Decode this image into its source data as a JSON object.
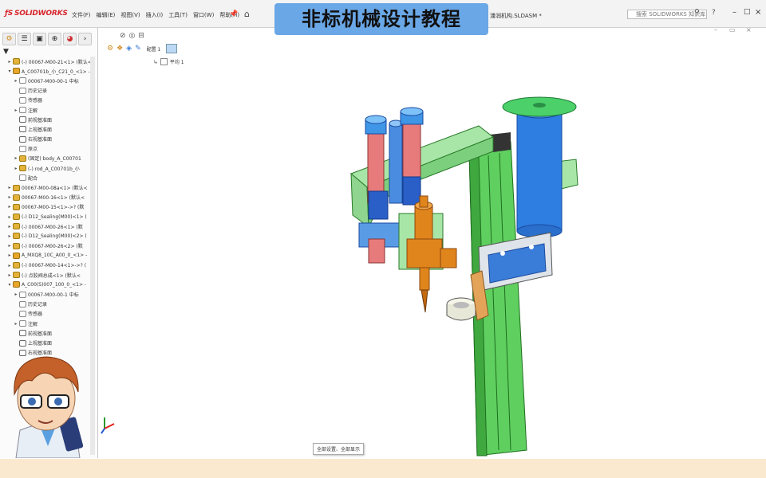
{
  "app": {
    "logo": "SOLIDWORKS"
  },
  "menu": {
    "items": [
      "文件(F)",
      "编辑(E)",
      "视图(V)",
      "插入(I)",
      "工具(T)",
      "窗口(W)",
      "帮助(H)"
    ]
  },
  "document_title": "潘润机构.SLDASM *",
  "search": {
    "placeholder": "搜索 SOLIDWORKS 知识库"
  },
  "banner": {
    "text": "非标机械设计教程"
  },
  "feature_tree": {
    "rows": [
      {
        "label": "(-) 00067-M00-21<1> (默认<",
        "icon": "part",
        "arrow": "▸",
        "indent": 1
      },
      {
        "label": "A_C00701b_小_C21_0_<1> -",
        "icon": "asm",
        "arrow": "▾",
        "indent": 1
      },
      {
        "label": "00067-M00-00-1 中标",
        "icon": "folder",
        "arrow": "▸",
        "indent": 2
      },
      {
        "label": "历史记录",
        "icon": "folder",
        "arrow": "",
        "indent": 2
      },
      {
        "label": "传感器",
        "icon": "folder",
        "arrow": "",
        "indent": 2
      },
      {
        "label": "注解",
        "icon": "folder",
        "arrow": "▸",
        "indent": 2
      },
      {
        "label": "前视基准面",
        "icon": "plane",
        "arrow": "",
        "indent": 2
      },
      {
        "label": "上视基准面",
        "icon": "plane",
        "arrow": "",
        "indent": 2
      },
      {
        "label": "右视基准面",
        "icon": "plane",
        "arrow": "",
        "indent": 2
      },
      {
        "label": "原点",
        "icon": "folder",
        "arrow": "",
        "indent": 2
      },
      {
        "label": "(固定) body_A_C00701",
        "icon": "part",
        "arrow": "▸",
        "indent": 2
      },
      {
        "label": "(-) rod_A_C00701b_小",
        "icon": "part",
        "arrow": "▸",
        "indent": 2
      },
      {
        "label": "配合",
        "icon": "folder",
        "arrow": "",
        "indent": 2
      },
      {
        "label": "00067-M00-08a<1> (默认<",
        "icon": "part",
        "arrow": "▸",
        "indent": 1
      },
      {
        "label": "00067-M00-16<1> (默认<",
        "icon": "part",
        "arrow": "▸",
        "indent": 1
      },
      {
        "label": "00067-M00-15<1>->? (默",
        "icon": "part",
        "arrow": "▸",
        "indent": 1
      },
      {
        "label": "(-) D12_Sealing(M00)<1> (",
        "icon": "part",
        "arrow": "▸",
        "indent": 1
      },
      {
        "label": "(-) 00067-M00-26<1> (默",
        "icon": "part",
        "arrow": "▸",
        "indent": 1
      },
      {
        "label": "(-) D12_Sealing(M00)<2> (",
        "icon": "part",
        "arrow": "▸",
        "indent": 1
      },
      {
        "label": "(-) 00067-M00-26<2> (默",
        "icon": "part",
        "arrow": "▸",
        "indent": 1
      },
      {
        "label": "A_MXQ8_10C_A00_0_<1> -",
        "icon": "asm",
        "arrow": "▸",
        "indent": 1
      },
      {
        "label": "(-) 00067-M00-14<1>->? (",
        "icon": "part",
        "arrow": "▸",
        "indent": 1
      },
      {
        "label": "(-) 点胶阀总成<1> (默认<",
        "icon": "part",
        "arrow": "▸",
        "indent": 1
      },
      {
        "label": "A_C00(S)007_100_0_<1> -",
        "icon": "asm",
        "arrow": "▾",
        "indent": 1
      },
      {
        "label": "00067-M00-00-1 中标",
        "icon": "folder",
        "arrow": "▸",
        "indent": 2
      },
      {
        "label": "历史记录",
        "icon": "folder",
        "arrow": "",
        "indent": 2
      },
      {
        "label": "传感器",
        "icon": "folder",
        "arrow": "",
        "indent": 2
      },
      {
        "label": "注解",
        "icon": "folder",
        "arrow": "▸",
        "indent": 2
      },
      {
        "label": "前视基准面",
        "icon": "plane",
        "arrow": "",
        "indent": 2
      },
      {
        "label": "上视基准面",
        "icon": "plane",
        "arrow": "",
        "indent": 2
      },
      {
        "label": "右视基准面",
        "icon": "plane",
        "arrow": "",
        "indent": 2
      }
    ]
  },
  "graphics": {
    "tooltip": "全部设置、全部显示",
    "config_tab": "配置 1",
    "feature_label": "平均 1"
  },
  "colors": {
    "frame_green": "#5fcf5f",
    "frame_light": "#a8e6a8",
    "cylinder_blue": "#2e7de0",
    "valve_orange": "#e0841c",
    "banner_blue": "#6aa7e6",
    "bottom_strip": "#fbe9cf"
  }
}
